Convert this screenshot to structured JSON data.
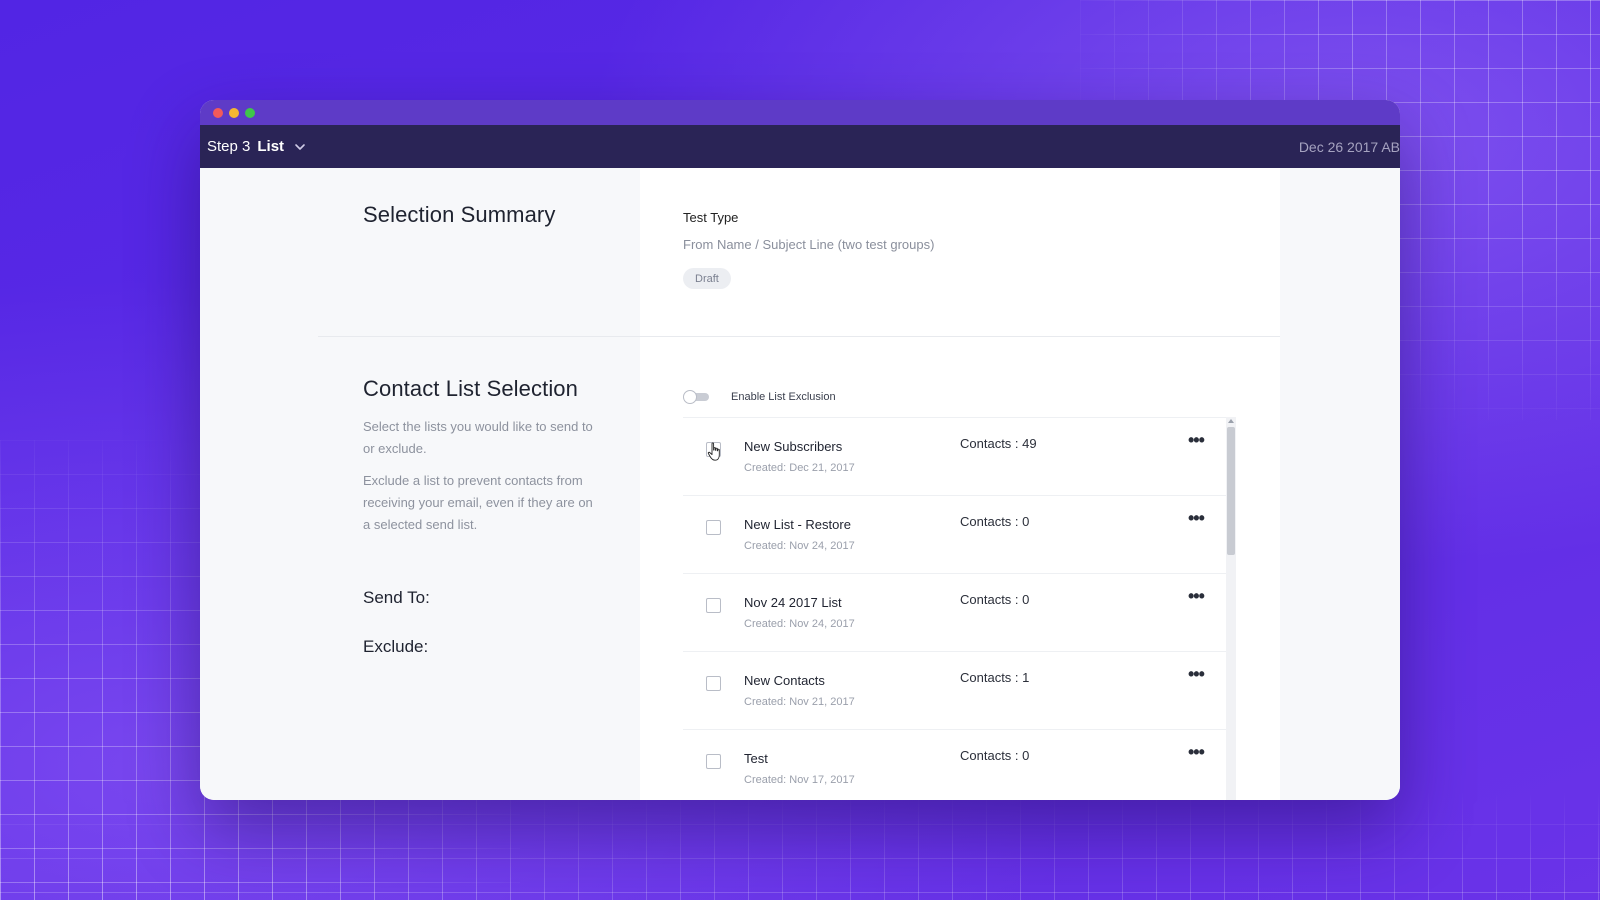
{
  "window": {
    "controls": [
      "close",
      "minimize",
      "maximize"
    ]
  },
  "topbar": {
    "step_label": "Step 3",
    "step_name": "List",
    "right_text": "Dec 26 2017 AB"
  },
  "summary": {
    "title": "Selection Summary",
    "test_type_label": "Test Type",
    "test_type_value": "From Name / Subject Line (two test groups)",
    "status_badge": "Draft"
  },
  "contact_selection": {
    "title": "Contact List Selection",
    "desc_1": "Select the lists you would like to send to or exclude.",
    "desc_2": "Exclude a list to prevent contacts from receiving your email, even if they are on a selected send list.",
    "send_to_label": "Send To:",
    "exclude_label": "Exclude:",
    "toggle_label": "Enable List Exclusion",
    "toggle_on": false
  },
  "lists": [
    {
      "name": "New Subscribers",
      "created": "Created: Dec 21, 2017",
      "contacts": "Contacts : 49",
      "checked": false
    },
    {
      "name": "New List - Restore",
      "created": "Created: Nov 24, 2017",
      "contacts": "Contacts : 0",
      "checked": false
    },
    {
      "name": "Nov 24 2017 List",
      "created": "Created: Nov 24, 2017",
      "contacts": "Contacts : 0",
      "checked": false
    },
    {
      "name": "New Contacts",
      "created": "Created: Nov 21, 2017",
      "contacts": "Contacts : 1",
      "checked": false
    },
    {
      "name": "Test",
      "created": "Created: Nov 17, 2017",
      "contacts": "Contacts : 0",
      "checked": false
    }
  ],
  "more_glyph": "•••",
  "colors": {
    "background": "#5a2de6",
    "titlebar": "#5e3bc7",
    "topbar": "#2a2456"
  }
}
